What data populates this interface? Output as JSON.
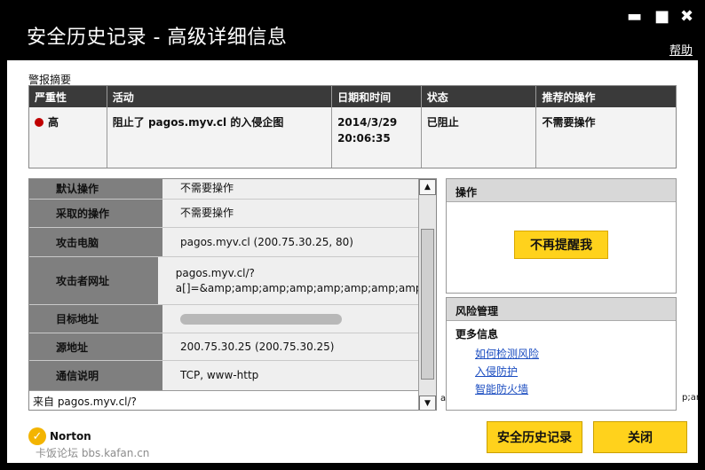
{
  "window": {
    "title": "安全历史记录 - 高级详细信息",
    "minimize": "▬",
    "maximize": "■",
    "close": "✖",
    "help": "帮助"
  },
  "summary": {
    "label": "警报摘要",
    "headers": [
      "严重性",
      "活动",
      "日期和时间",
      "状态",
      "推荐的操作"
    ],
    "row": {
      "severity": "高",
      "activity": "阻止了 pagos.myv.cl 的入侵企图",
      "date": "2014/3/29",
      "time": "20:06:35",
      "status": "已阻止",
      "recommendation": "不需要操作"
    }
  },
  "details": [
    {
      "key": "默认操作",
      "value": "不需要操作"
    },
    {
      "key": "采取的操作",
      "value": "不需要操作"
    },
    {
      "key": "攻击电脑",
      "value": "pagos.myv.cl (200.75.30.25, 80)"
    },
    {
      "key": "攻击者网址",
      "value": "pagos.myv.cl/?\na[]=&amp;amp;amp;amp;amp;amp;amp;amp;..."
    },
    {
      "key": "目标地址",
      "value": ""
    },
    {
      "key": "源地址",
      "value": "200.75.30.25 (200.75.30.25)"
    },
    {
      "key": "通信说明",
      "value": "TCP, www-http"
    }
  ],
  "from_text": "来自 pagos.myv.cl/?",
  "actions": {
    "title": "操作",
    "button": "不再提醒我"
  },
  "risk": {
    "title": "风险管理",
    "more": "更多信息",
    "links": [
      "如何检测风险",
      "入侵防护",
      "智能防火墙"
    ]
  },
  "footer": {
    "history": "安全历史记录",
    "close": "关闭",
    "logo": "Norton",
    "watermark": "卡饭论坛 bbs.kafan.cn"
  },
  "misc": {
    "cut_left": "a",
    "cut_right": "p;ar"
  },
  "colors": {
    "accent": "#ffd21c",
    "severity_high": "#c00000",
    "link": "#1a4cc0"
  }
}
